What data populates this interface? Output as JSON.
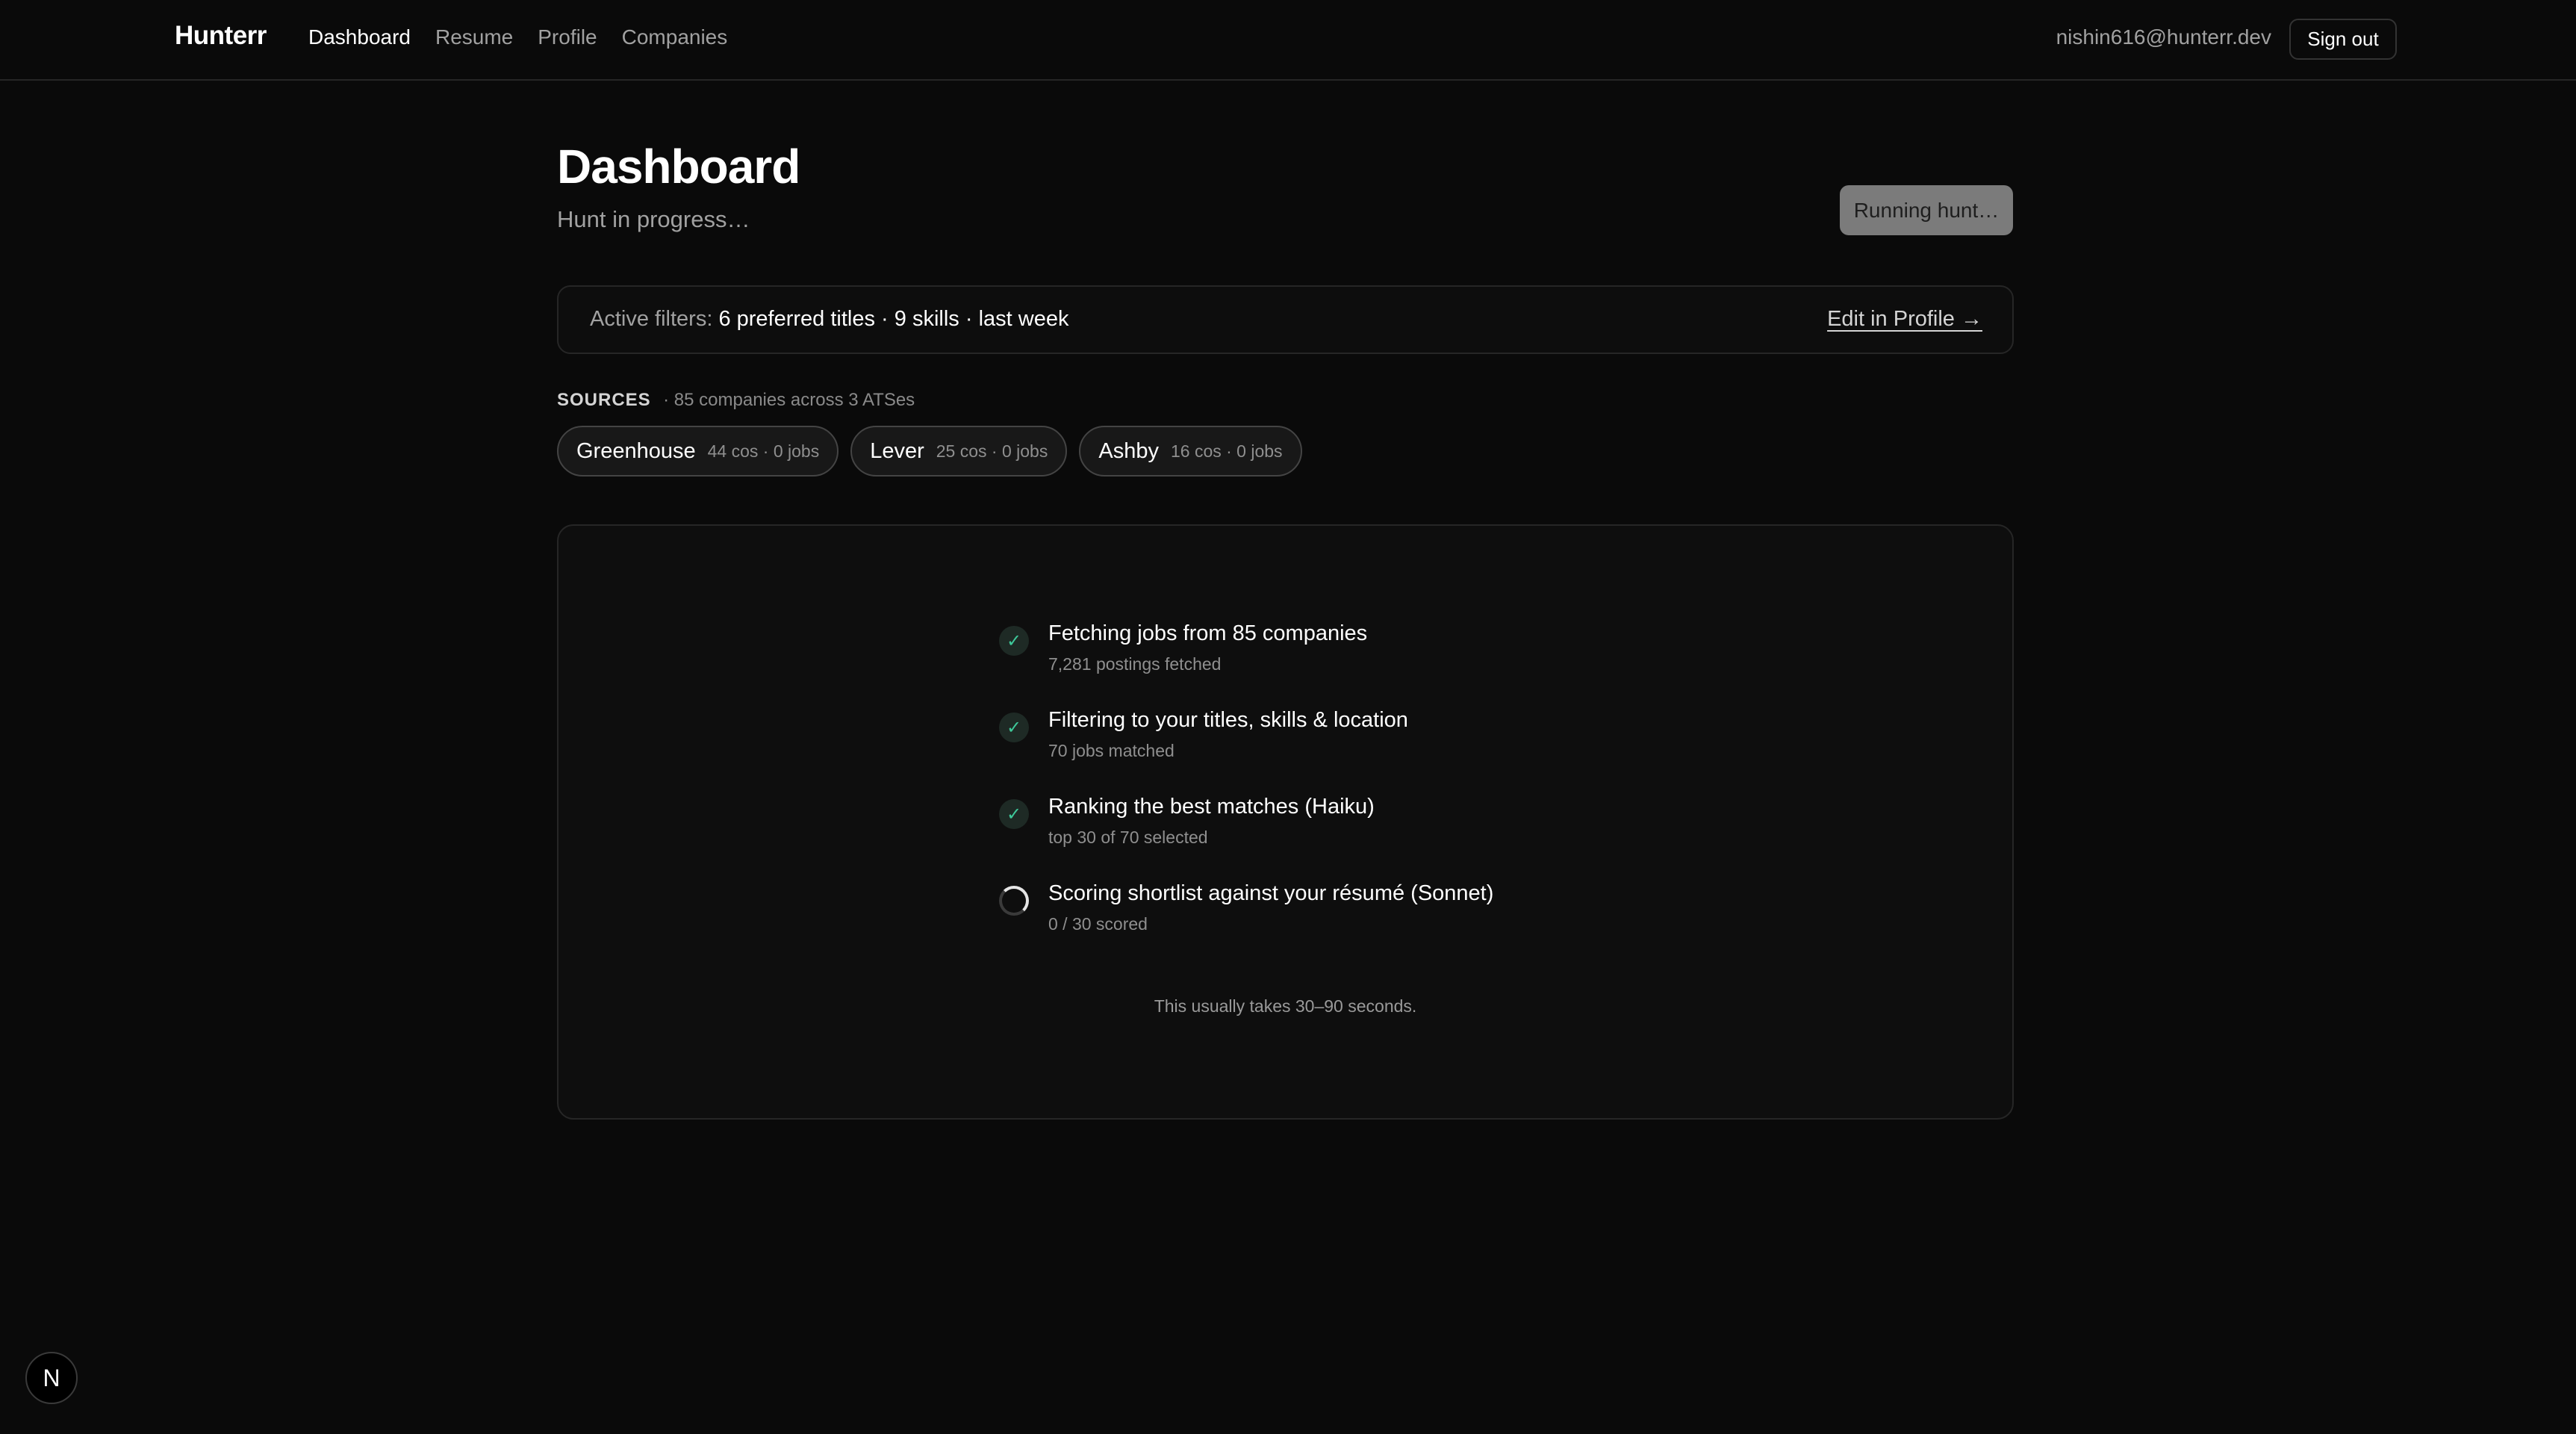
{
  "nav": {
    "brand": "Hunterr",
    "links": [
      {
        "label": "Dashboard",
        "active": true
      },
      {
        "label": "Resume",
        "active": false
      },
      {
        "label": "Profile",
        "active": false
      },
      {
        "label": "Companies",
        "active": false
      }
    ],
    "email": "nishin616@hunterr.dev",
    "signout_label": "Sign out"
  },
  "header": {
    "title": "Dashboard",
    "subtitle": "Hunt in progress…",
    "run_button_label": "Running hunt…"
  },
  "filters": {
    "label": "Active filters:",
    "titles": "6 preferred titles",
    "skills": "9 skills",
    "recency": "last week",
    "separator": " · ",
    "edit_label": "Edit in Profile →"
  },
  "sources": {
    "label": "SOURCES",
    "meta": "· 85 companies across 3 ATSes",
    "items": [
      {
        "name": "Greenhouse",
        "meta": "44 cos · 0 jobs"
      },
      {
        "name": "Lever",
        "meta": "25 cos · 0 jobs"
      },
      {
        "name": "Ashby",
        "meta": "16 cos · 0 jobs"
      }
    ]
  },
  "progress": {
    "steps": [
      {
        "title": "Fetching jobs from 85 companies",
        "sub": "7,281 postings fetched",
        "status": "done"
      },
      {
        "title": "Filtering to your titles, skills & location",
        "sub": "70 jobs matched",
        "status": "done"
      },
      {
        "title": "Ranking the best matches (Haiku)",
        "sub": "top 30 of 70 selected",
        "status": "done"
      },
      {
        "title": "Scoring shortlist against your résumé (Sonnet)",
        "sub": "0 / 30 scored",
        "status": "running"
      }
    ],
    "note": "This usually takes 30–90 seconds."
  },
  "badge": {
    "label": "N",
    "icon": "nextjs-icon"
  },
  "colors": {
    "background": "#0a0a0a",
    "border": "#262626",
    "done_check": "#3ec99a",
    "run_button": "#7b7b7b"
  }
}
